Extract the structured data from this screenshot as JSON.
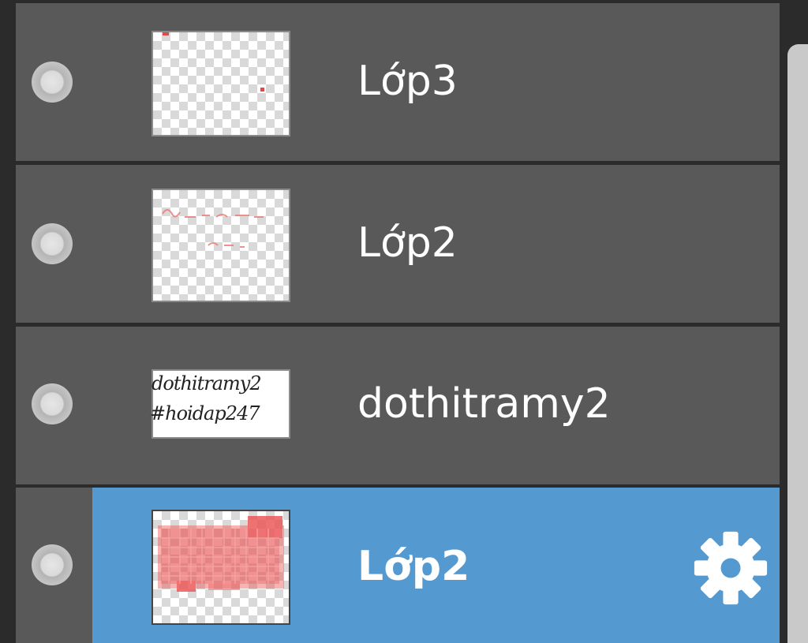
{
  "layers": [
    {
      "name": "Lớp3",
      "visible": true,
      "selected": false,
      "thumbnail": "transparent-with-red-dots"
    },
    {
      "name": "Lớp2",
      "visible": true,
      "selected": false,
      "thumbnail": "transparent-with-faint-red-text"
    },
    {
      "name": "dothitramy2",
      "visible": true,
      "selected": false,
      "thumbnail": "handwriting",
      "thumb_text": [
        "dothitramy2",
        "#hoidap247"
      ]
    },
    {
      "name": "Lớp2",
      "visible": true,
      "selected": true,
      "thumbnail": "red-wash"
    }
  ],
  "icons": {
    "visibility": "radio-dot-icon",
    "settings": "gear-icon"
  },
  "colors": {
    "row_bg": "#595959",
    "selected_bg": "#5499d0",
    "panel_bg": "#2b2b2b",
    "text": "#ffffff",
    "scrollbar": "#c9c9c9"
  }
}
